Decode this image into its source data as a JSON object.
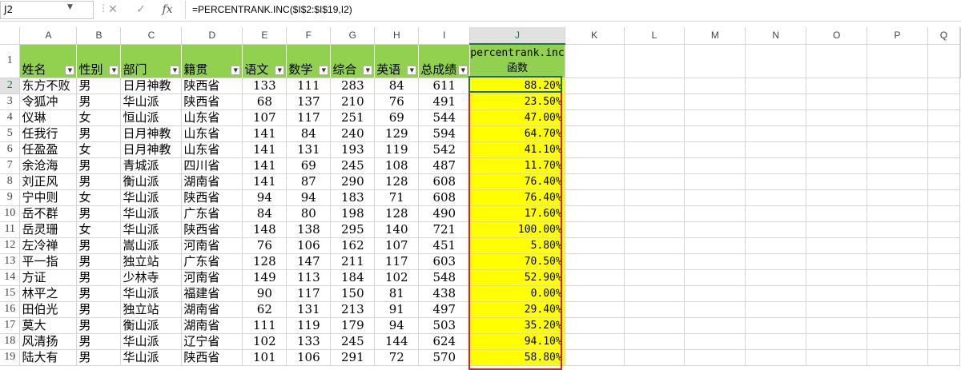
{
  "formula_bar": {
    "name_box": "J2",
    "fx_label": "fx",
    "cancel_icon": "✕",
    "enter_icon": "✓",
    "formula": "=PERCENTRANK.INC($I$2:$I$19,I2)"
  },
  "column_letters": [
    "A",
    "B",
    "C",
    "D",
    "E",
    "F",
    "G",
    "H",
    "I",
    "J",
    "K",
    "L",
    "M",
    "N",
    "O",
    "P",
    "Q"
  ],
  "header_row": {
    "row_number": "1",
    "labels": [
      "姓名",
      "性别",
      "部门",
      "籍贯",
      "语文",
      "数学",
      "综合",
      "英语",
      "总成绩"
    ],
    "j_label": "percentrank.inc函数"
  },
  "rows": [
    {
      "n": "2",
      "name": "东方不败",
      "sex": "男",
      "dept": "日月神教",
      "place": "陕西省",
      "chinese": "133",
      "math": "111",
      "comp": "283",
      "english": "84",
      "total": "611",
      "pct": "88.20%"
    },
    {
      "n": "3",
      "name": "令狐冲",
      "sex": "男",
      "dept": "华山派",
      "place": "陕西省",
      "chinese": "68",
      "math": "137",
      "comp": "210",
      "english": "76",
      "total": "491",
      "pct": "23.50%"
    },
    {
      "n": "4",
      "name": "仪琳",
      "sex": "女",
      "dept": "恒山派",
      "place": "山东省",
      "chinese": "107",
      "math": "117",
      "comp": "251",
      "english": "69",
      "total": "544",
      "pct": "47.00%"
    },
    {
      "n": "5",
      "name": "任我行",
      "sex": "男",
      "dept": "日月神教",
      "place": "山东省",
      "chinese": "141",
      "math": "84",
      "comp": "240",
      "english": "129",
      "total": "594",
      "pct": "64.70%"
    },
    {
      "n": "6",
      "name": "任盈盈",
      "sex": "女",
      "dept": "日月神教",
      "place": "山东省",
      "chinese": "141",
      "math": "131",
      "comp": "193",
      "english": "119",
      "total": "542",
      "pct": "41.10%"
    },
    {
      "n": "7",
      "name": "余沧海",
      "sex": "男",
      "dept": "青城派",
      "place": "四川省",
      "chinese": "141",
      "math": "69",
      "comp": "245",
      "english": "108",
      "total": "487",
      "pct": "11.70%"
    },
    {
      "n": "8",
      "name": "刘正风",
      "sex": "男",
      "dept": "衡山派",
      "place": "湖南省",
      "chinese": "141",
      "math": "87",
      "comp": "290",
      "english": "128",
      "total": "608",
      "pct": "76.40%"
    },
    {
      "n": "9",
      "name": "宁中则",
      "sex": "女",
      "dept": "华山派",
      "place": "陕西省",
      "chinese": "94",
      "math": "94",
      "comp": "183",
      "english": "71",
      "total": "608",
      "pct": "76.40%"
    },
    {
      "n": "10",
      "name": "岳不群",
      "sex": "男",
      "dept": "华山派",
      "place": "广东省",
      "chinese": "84",
      "math": "80",
      "comp": "198",
      "english": "128",
      "total": "490",
      "pct": "17.60%"
    },
    {
      "n": "11",
      "name": "岳灵珊",
      "sex": "女",
      "dept": "华山派",
      "place": "陕西省",
      "chinese": "148",
      "math": "138",
      "comp": "295",
      "english": "140",
      "total": "721",
      "pct": "100.00%"
    },
    {
      "n": "12",
      "name": "左冷禅",
      "sex": "男",
      "dept": "嵩山派",
      "place": "河南省",
      "chinese": "76",
      "math": "106",
      "comp": "162",
      "english": "107",
      "total": "451",
      "pct": "5.80%"
    },
    {
      "n": "13",
      "name": "平一指",
      "sex": "男",
      "dept": "独立站",
      "place": "广东省",
      "chinese": "128",
      "math": "147",
      "comp": "211",
      "english": "117",
      "total": "603",
      "pct": "70.50%"
    },
    {
      "n": "14",
      "name": "方证",
      "sex": "男",
      "dept": "少林寺",
      "place": "河南省",
      "chinese": "149",
      "math": "113",
      "comp": "184",
      "english": "102",
      "total": "548",
      "pct": "52.90%"
    },
    {
      "n": "15",
      "name": "林平之",
      "sex": "男",
      "dept": "华山派",
      "place": "福建省",
      "chinese": "90",
      "math": "117",
      "comp": "150",
      "english": "81",
      "total": "438",
      "pct": "0.00%"
    },
    {
      "n": "16",
      "name": "田伯光",
      "sex": "男",
      "dept": "独立站",
      "place": "湖南省",
      "chinese": "62",
      "math": "131",
      "comp": "213",
      "english": "91",
      "total": "497",
      "pct": "29.40%"
    },
    {
      "n": "17",
      "name": "莫大",
      "sex": "男",
      "dept": "衡山派",
      "place": "湖南省",
      "chinese": "111",
      "math": "119",
      "comp": "179",
      "english": "94",
      "total": "503",
      "pct": "35.20%"
    },
    {
      "n": "18",
      "name": "风清扬",
      "sex": "男",
      "dept": "华山派",
      "place": "辽宁省",
      "chinese": "102",
      "math": "133",
      "comp": "245",
      "english": "144",
      "total": "624",
      "pct": "94.10%"
    },
    {
      "n": "19",
      "name": "陆大有",
      "sex": "男",
      "dept": "华山派",
      "place": "陕西省",
      "chinese": "101",
      "math": "106",
      "comp": "291",
      "english": "72",
      "total": "570",
      "pct": "58.80%"
    }
  ],
  "colors": {
    "header_fill": "#92d050",
    "highlight_fill": "#ffff00",
    "outline": "#e02020",
    "accent": "#217346"
  }
}
